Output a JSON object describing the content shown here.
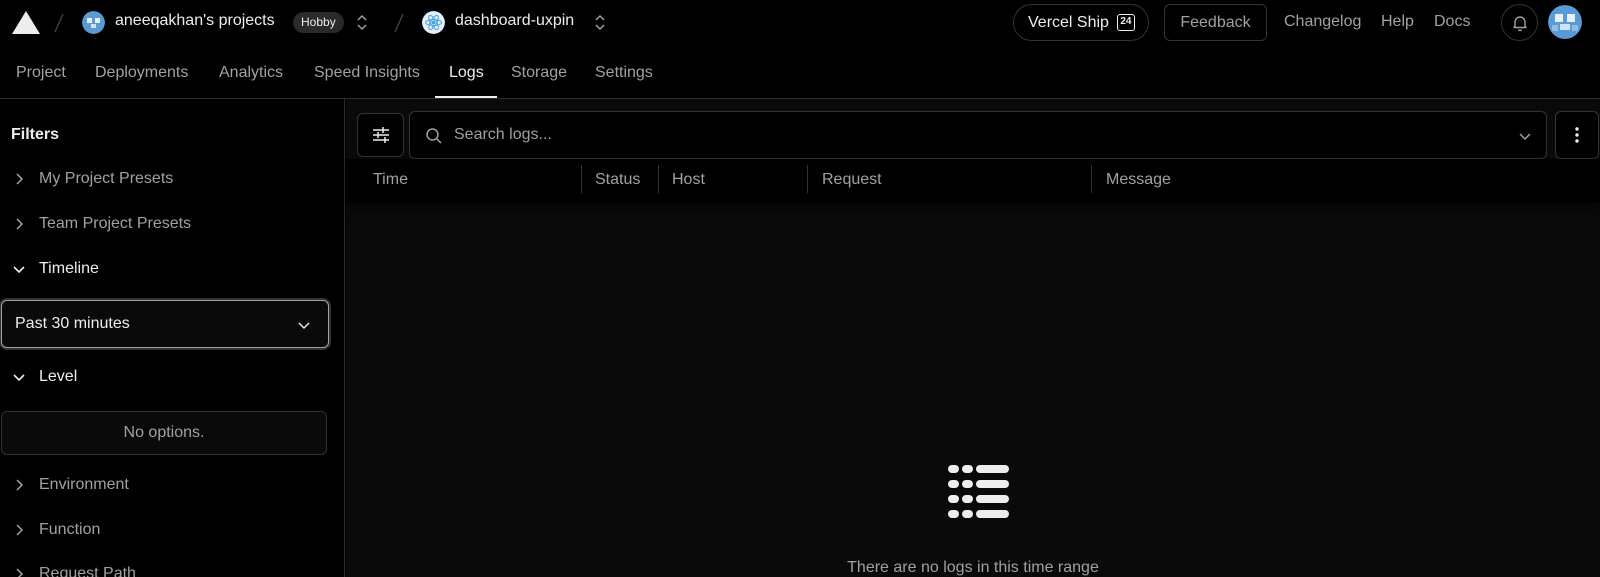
{
  "header": {
    "team_name": "aneeqakhan's projects",
    "plan_badge": "Hobby",
    "project_name": "dashboard-uxpin",
    "ship_label": "Vercel Ship",
    "ship_badge": "24",
    "feedback_label": "Feedback",
    "links": [
      "Changelog",
      "Help",
      "Docs"
    ]
  },
  "tabs": [
    {
      "label": "Project",
      "active": false
    },
    {
      "label": "Deployments",
      "active": false
    },
    {
      "label": "Analytics",
      "active": false
    },
    {
      "label": "Speed Insights",
      "active": false
    },
    {
      "label": "Logs",
      "active": true
    },
    {
      "label": "Storage",
      "active": false
    },
    {
      "label": "Settings",
      "active": false
    }
  ],
  "sidebar": {
    "title": "Filters",
    "sections": [
      {
        "label": "My Project Presets",
        "expanded": false
      },
      {
        "label": "Team Project Presets",
        "expanded": false
      },
      {
        "label": "Timeline",
        "expanded": true
      },
      {
        "label": "Level",
        "expanded": true
      },
      {
        "label": "Environment",
        "expanded": false
      },
      {
        "label": "Function",
        "expanded": false
      },
      {
        "label": "Request Path",
        "expanded": false
      }
    ],
    "timeline_value": "Past 30 minutes",
    "level_empty": "No options."
  },
  "search": {
    "placeholder": "Search logs..."
  },
  "table": {
    "columns": [
      "Time",
      "Status",
      "Host",
      "Request",
      "Message"
    ]
  },
  "empty_state": {
    "message": "There are no logs in this time range"
  },
  "icons": {
    "logo": "vercel-triangle-icon",
    "bell": "bell-icon",
    "filter": "sliders-icon",
    "search": "search-icon",
    "more": "more-vertical-icon",
    "empty": "list-icon"
  },
  "colors": {
    "background": "#000000",
    "panel": "#0a0a0a",
    "text": "#ededed",
    "muted": "#a1a1a1",
    "border": "#333333"
  }
}
